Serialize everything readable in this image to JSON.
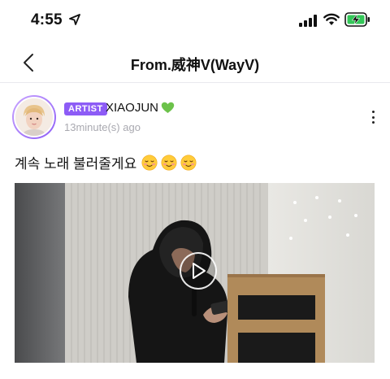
{
  "status_bar": {
    "time": "4:55",
    "icons": [
      "location-arrow-icon",
      "cellular-signal-icon",
      "wifi-icon",
      "battery-charging-icon"
    ],
    "battery_color": "#34c759"
  },
  "nav": {
    "back_icon": "chevron-left-icon",
    "title": "From.威神V(WayV)"
  },
  "post": {
    "badge": "ARTIST",
    "author": "XIAOJUN",
    "author_emoji": "green-heart-icon",
    "time_ago": "13minute(s) ago",
    "more_icon": "more-vertical-icon",
    "text": "계속 노래 불러줄게요",
    "text_emojis": [
      "smiling-face-icon",
      "smiling-face-icon",
      "smiling-face-icon"
    ],
    "media": {
      "type": "video",
      "play_icon": "play-icon"
    }
  },
  "colors": {
    "accent": "#8d5cf6",
    "divider": "#e9e9ee",
    "muted_text": "#a9a9b0"
  }
}
